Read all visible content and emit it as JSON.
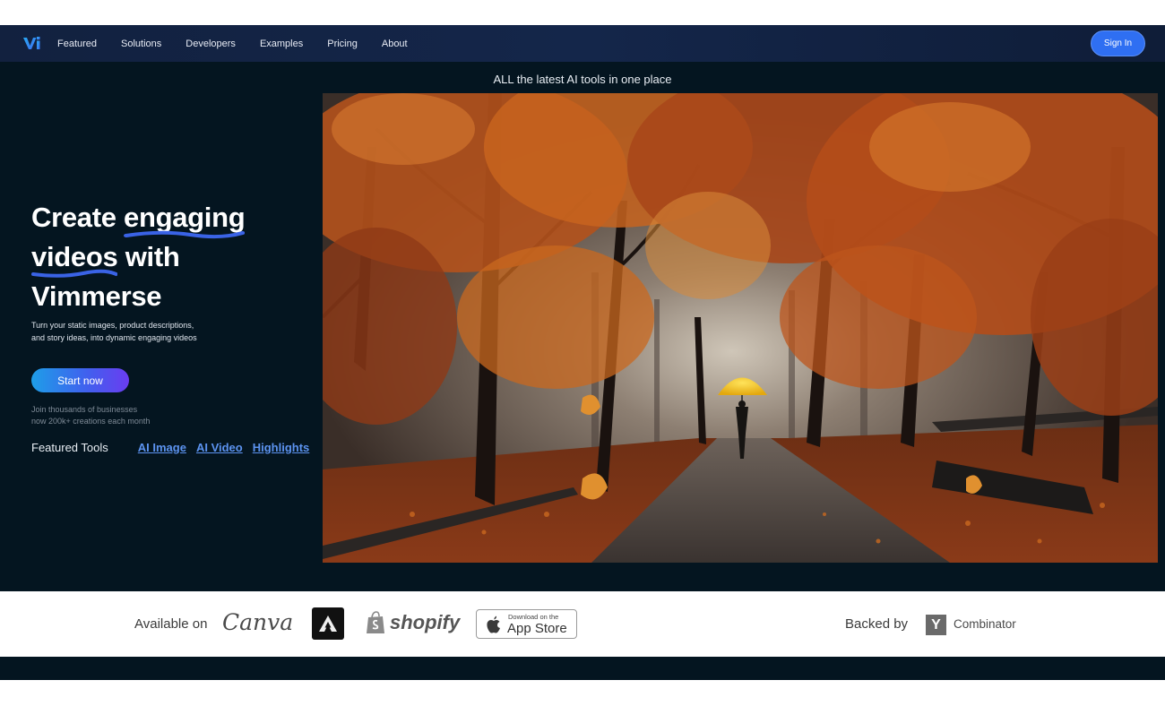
{
  "brand": {
    "logo_text": "Vi"
  },
  "nav": {
    "items": [
      {
        "label": "Featured"
      },
      {
        "label": "Solutions"
      },
      {
        "label": "Developers"
      },
      {
        "label": "Examples"
      },
      {
        "label": "Pricing"
      },
      {
        "label": "About"
      }
    ],
    "signin_label": "Sign In"
  },
  "hero": {
    "tagline": "ALL the latest AI tools in one place",
    "title": {
      "part1": "Create ",
      "highlight1": "engaging",
      "highlight2": "videos",
      "part2": " with",
      "part3": "Vimmerse"
    },
    "subtitle_line1": "Turn your static images, product descriptions,",
    "subtitle_line2": "and story ideas, into dynamic engaging videos",
    "cta_label": "Start now",
    "join_line1": "Join thousands of businesses",
    "join_line2": "now 200k+ creations each month",
    "featured_label": "Featured Tools",
    "featured_links": [
      {
        "label": "AI Image"
      },
      {
        "label": "AI Video"
      },
      {
        "label": "Highlights"
      }
    ]
  },
  "partners": {
    "available_label": "Available on",
    "canva": "Canva",
    "shopify": "shopify",
    "appstore_small": "Download on the",
    "appstore_big": "App Store",
    "backed_label": "Backed by",
    "yc_letter": "Y",
    "yc_text": "Combinator"
  },
  "colors": {
    "nav_bg": "#12213f",
    "hero_bg": "#041520",
    "accent": "#2f6ff2",
    "link": "#5c93f0",
    "umbrella": "#f2c21a"
  },
  "icons": [
    "vimmerse-logo-icon",
    "adobe-express-icon",
    "shopify-bag-icon",
    "apple-icon",
    "y-combinator-icon"
  ]
}
